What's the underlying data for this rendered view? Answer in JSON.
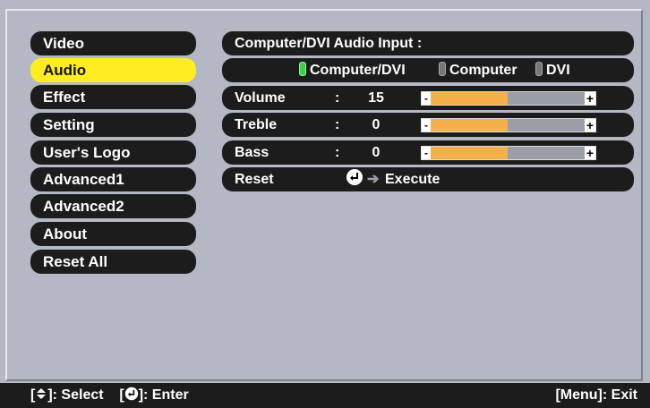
{
  "sidebar": {
    "items": [
      {
        "label": "Video",
        "selected": false
      },
      {
        "label": "Audio",
        "selected": true
      },
      {
        "label": "Effect",
        "selected": false
      },
      {
        "label": "Setting",
        "selected": false
      },
      {
        "label": "User's Logo",
        "selected": false
      },
      {
        "label": "Advanced1",
        "selected": false
      },
      {
        "label": "Advanced2",
        "selected": false
      },
      {
        "label": "About",
        "selected": false
      },
      {
        "label": "Reset All",
        "selected": false
      }
    ]
  },
  "audio": {
    "input_title": "Computer/DVI Audio Input :",
    "input_options": [
      {
        "label": "Computer/DVI",
        "selected": true
      },
      {
        "label": "Computer",
        "selected": false
      },
      {
        "label": "DVI",
        "selected": false
      }
    ],
    "settings": [
      {
        "label": "Volume",
        "colon": ":",
        "value": "15",
        "level": 0.5
      },
      {
        "label": "Treble",
        "colon": ":",
        "value": "0",
        "level": 0.5
      },
      {
        "label": "Bass",
        "colon": ":",
        "value": "0",
        "level": 0.5
      }
    ],
    "bar_minus": "-",
    "bar_plus": "+",
    "reset_label": "Reset",
    "execute_label": "Execute"
  },
  "footer": {
    "select_prefix": "[",
    "select_suffix": "]: Select",
    "enter_prefix": "[",
    "enter_suffix": "]: Enter",
    "exit_label": "[Menu]: Exit"
  },
  "colors": {
    "background": "#b3b8c4",
    "pill": "#1c1c1c",
    "highlight": "#ffed22",
    "bar_fill": "#f6b04a",
    "radio_on": "#39d24a"
  },
  "icons": {
    "updown": "up-down-arrow-icon",
    "enter": "enter-icon",
    "arrow": "right-arrow-icon"
  }
}
